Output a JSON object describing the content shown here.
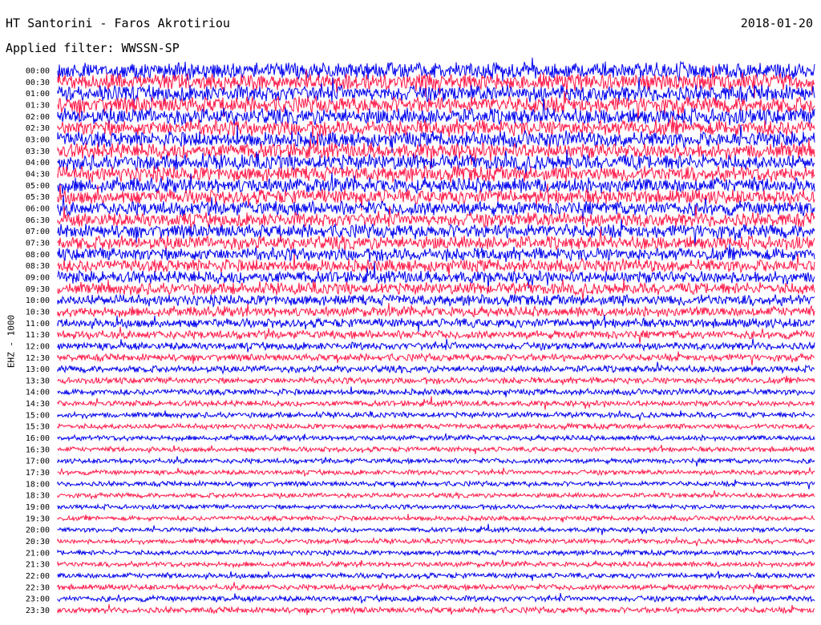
{
  "header": {
    "station": "HT Santorini - Faros Akrotiriou",
    "date": "2018-01-20",
    "filter_label": "Applied filter: WWSSN-SP"
  },
  "chart_data": {
    "type": "line",
    "title": "HT Santorini - Faros Akrotiriou",
    "ylabel": "EHZ - 1000",
    "row_labels": [
      "00:00",
      "00:30",
      "01:00",
      "01:30",
      "02:00",
      "02:30",
      "03:00",
      "03:30",
      "04:00",
      "04:30",
      "05:00",
      "05:30",
      "06:00",
      "06:30",
      "07:00",
      "07:30",
      "08:00",
      "08:30",
      "09:00",
      "09:30",
      "10:00",
      "10:30",
      "11:00",
      "11:30",
      "12:00",
      "12:30",
      "13:00",
      "13:30",
      "14:00",
      "14:30",
      "15:00",
      "15:30",
      "16:00",
      "16:30",
      "17:00",
      "17:30",
      "18:00",
      "18:30",
      "19:00",
      "19:30",
      "20:00",
      "20:30",
      "21:00",
      "21:30",
      "22:00",
      "22:30",
      "23:00",
      "23:30"
    ],
    "trace_colors": [
      "#0000ee",
      "#ff1a4a"
    ],
    "relative_amplitude": [
      1.0,
      1.0,
      0.98,
      0.97,
      0.96,
      0.95,
      0.94,
      0.93,
      0.92,
      0.91,
      0.9,
      0.88,
      0.86,
      0.84,
      0.82,
      0.8,
      0.78,
      0.76,
      0.74,
      0.7,
      0.65,
      0.6,
      0.55,
      0.5,
      0.45,
      0.42,
      0.4,
      0.38,
      0.36,
      0.34,
      0.33,
      0.32,
      0.31,
      0.3,
      0.3,
      0.29,
      0.29,
      0.28,
      0.28,
      0.28,
      0.28,
      0.29,
      0.3,
      0.31,
      0.32,
      0.33,
      0.34,
      0.35
    ]
  }
}
